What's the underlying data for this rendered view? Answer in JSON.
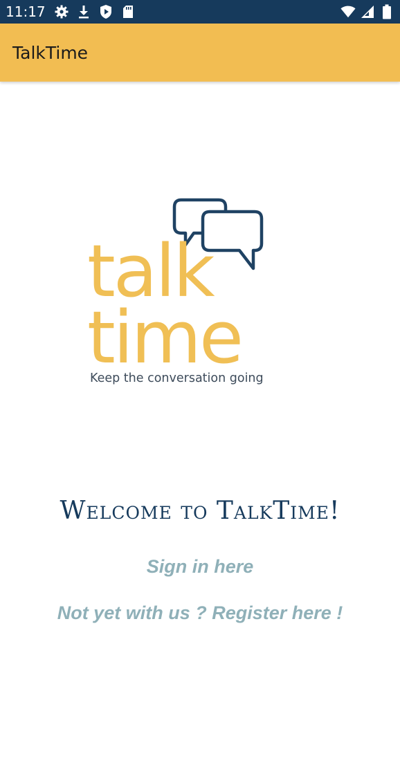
{
  "status_bar": {
    "time": "11:17",
    "left_icons": [
      "settings-icon",
      "download-icon",
      "shield-play-icon",
      "sd-card-icon"
    ],
    "right_icons": [
      "wifi-icon",
      "signal-icon",
      "battery-icon"
    ]
  },
  "app_bar": {
    "title": "TalkTime"
  },
  "logo": {
    "word1": "talk",
    "word2": "time",
    "tagline": "Keep the conversation going"
  },
  "welcome": {
    "text": "Welcome to TalkTime!"
  },
  "links": {
    "sign_in": "Sign in here",
    "register": "Not yet with us ? Register here !"
  },
  "colors": {
    "status_bar": "#163a5c",
    "app_bar": "#f2bd52",
    "logo_yellow": "#f0bf55",
    "navy": "#163a5c",
    "link": "#8fb0b8"
  }
}
